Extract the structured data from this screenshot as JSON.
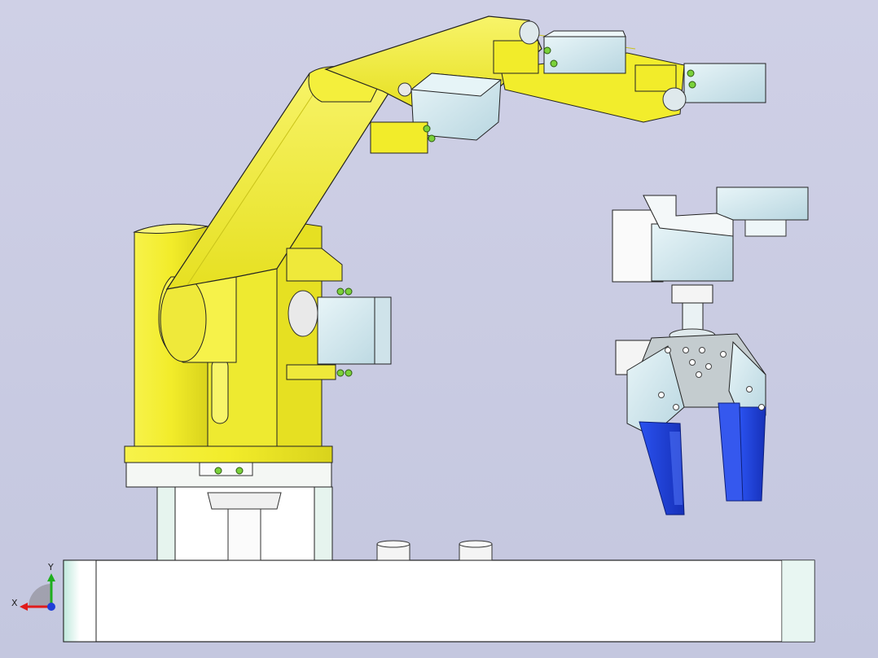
{
  "viewport": {
    "background_top": "#cfd0e6",
    "background_bottom": "#c4c7df"
  },
  "model": {
    "arm_color": "#f2ec2a",
    "arm_shadow": "#d8d21a",
    "servo_color": "#cfe6ee",
    "gripper_finger_color": "#1f3fd8",
    "base_plate_color": "#ffffff",
    "edge_color": "#222222",
    "screw_color": "#7ad13a"
  },
  "triad": {
    "x_label": "X",
    "y_label": "Y",
    "x_color": "#e01b1b",
    "y_color": "#1fae1f",
    "z_color": "#1f3fd8"
  }
}
